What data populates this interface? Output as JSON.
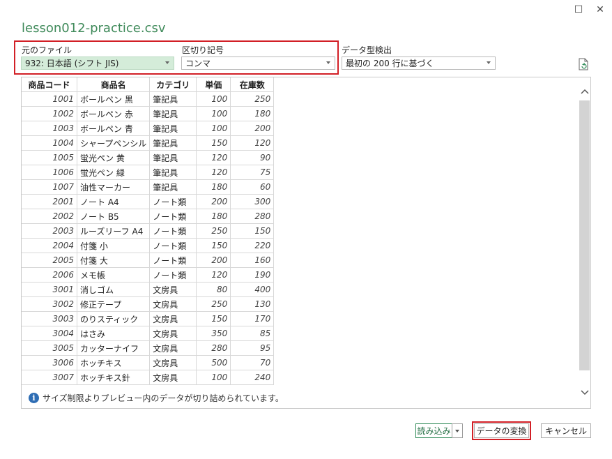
{
  "window": {
    "maximize_glyph": "☐",
    "close_glyph": "✕"
  },
  "title": "lesson012-practice.csv",
  "controls": {
    "file_origin_label": "元のファイル",
    "file_origin_value": "932: 日本語 (シフト JIS)",
    "delimiter_label": "区切り記号",
    "delimiter_value": "コンマ",
    "type_detection_label": "データ型検出",
    "type_detection_value": "最初の 200 行に基づく"
  },
  "table": {
    "headers": [
      "商品コード",
      "商品名",
      "カテゴリ",
      "単価",
      "在庫数"
    ],
    "rows": [
      [
        "1001",
        "ボールペン 黒",
        "筆記具",
        "100",
        "250"
      ],
      [
        "1002",
        "ボールペン 赤",
        "筆記具",
        "100",
        "180"
      ],
      [
        "1003",
        "ボールペン 青",
        "筆記具",
        "100",
        "200"
      ],
      [
        "1004",
        "シャープペンシル",
        "筆記具",
        "150",
        "120"
      ],
      [
        "1005",
        "蛍光ペン 黄",
        "筆記具",
        "120",
        "90"
      ],
      [
        "1006",
        "蛍光ペン 緑",
        "筆記具",
        "120",
        "75"
      ],
      [
        "1007",
        "油性マーカー",
        "筆記具",
        "180",
        "60"
      ],
      [
        "2001",
        "ノート A4",
        "ノート類",
        "200",
        "300"
      ],
      [
        "2002",
        "ノート B5",
        "ノート類",
        "180",
        "280"
      ],
      [
        "2003",
        "ルーズリーフ A4",
        "ノート類",
        "250",
        "150"
      ],
      [
        "2004",
        "付箋 小",
        "ノート類",
        "150",
        "220"
      ],
      [
        "2005",
        "付箋 大",
        "ノート類",
        "200",
        "160"
      ],
      [
        "2006",
        "メモ帳",
        "ノート類",
        "120",
        "190"
      ],
      [
        "3001",
        "消しゴム",
        "文房具",
        "80",
        "400"
      ],
      [
        "3002",
        "修正テープ",
        "文房具",
        "250",
        "130"
      ],
      [
        "3003",
        "のりスティック",
        "文房具",
        "150",
        "170"
      ],
      [
        "3004",
        "はさみ",
        "文房具",
        "350",
        "85"
      ],
      [
        "3005",
        "カッターナイフ",
        "文房具",
        "280",
        "95"
      ],
      [
        "3006",
        "ホッチキス",
        "文房具",
        "500",
        "70"
      ],
      [
        "3007",
        "ホッチキス針",
        "文房具",
        "100",
        "240"
      ]
    ]
  },
  "notice": "サイズ制限よりプレビュー内のデータが切り詰められています。",
  "buttons": {
    "load": "読み込み",
    "transform": "データの変換",
    "cancel": "キャンセル"
  },
  "colors": {
    "title": "#3f8a5a",
    "highlight": "#d21f26",
    "selected_dropdown": "#d4ecd9"
  }
}
